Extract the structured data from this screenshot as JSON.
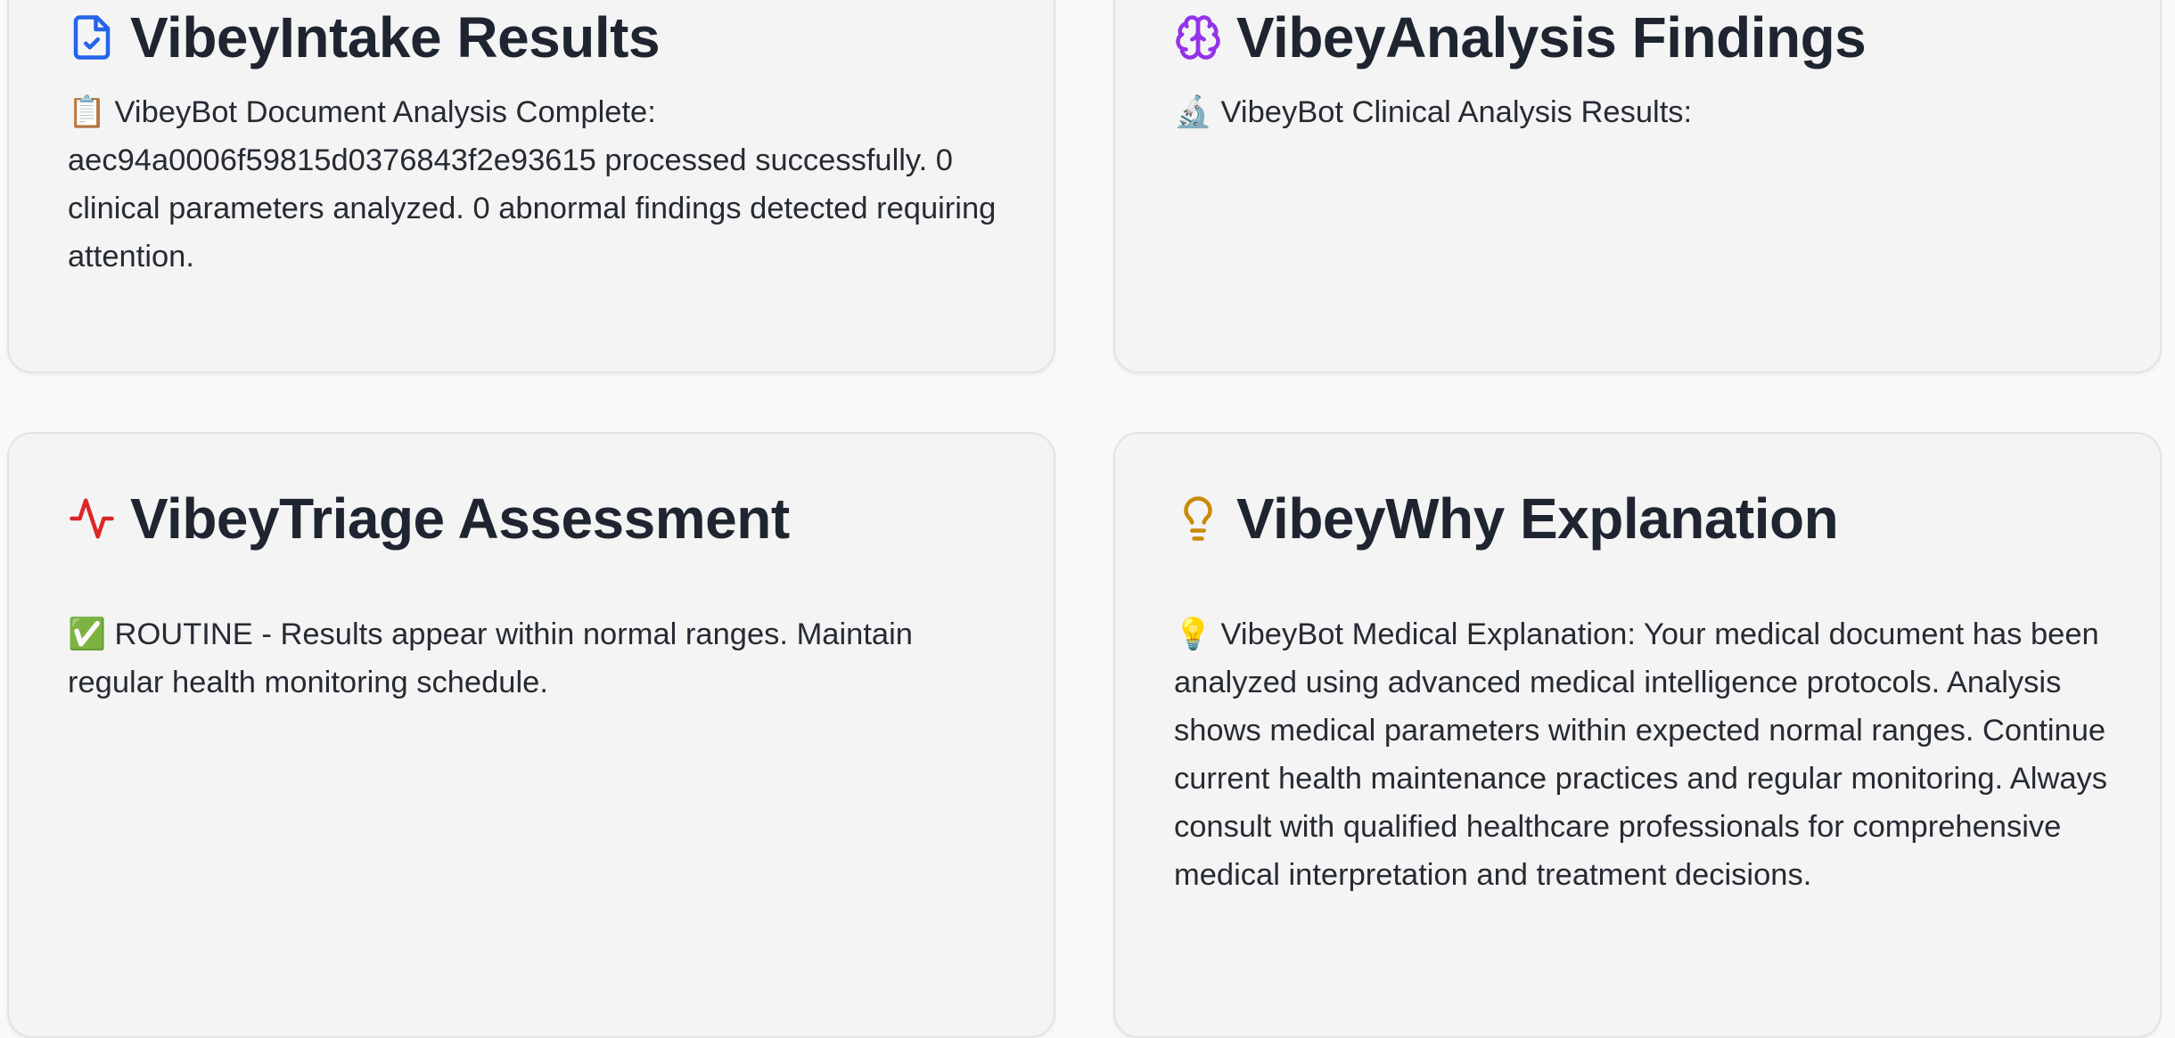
{
  "cards": {
    "intake": {
      "title": "VibeyIntake Results",
      "icon": "file-check-icon",
      "icon_color": "#2563eb",
      "body": "📋 VibeyBot Document Analysis Complete: aec94a0006f59815d0376843f2e93615 processed successfully. 0 clinical parameters analyzed. 0 abnormal findings detected requiring attention."
    },
    "analysis": {
      "title": "VibeyAnalysis Findings",
      "icon": "brain-icon",
      "icon_color": "#9333ea",
      "body": "🔬 VibeyBot Clinical Analysis Results:"
    },
    "triage": {
      "title": "VibeyTriage Assessment",
      "icon": "activity-icon",
      "icon_color": "#dc2626",
      "body": "✅ ROUTINE - Results appear within normal ranges. Maintain regular health monitoring schedule."
    },
    "why": {
      "title": "VibeyWhy Explanation",
      "icon": "lightbulb-icon",
      "icon_color": "#ca8a04",
      "body": "💡 VibeyBot Medical Explanation: Your medical document has been analyzed using advanced medical intelligence protocols. Analysis shows medical parameters within expected normal ranges. Continue current health maintenance practices and regular monitoring. Always consult with qualified healthcare professionals for comprehensive medical interpretation and treatment decisions."
    }
  }
}
